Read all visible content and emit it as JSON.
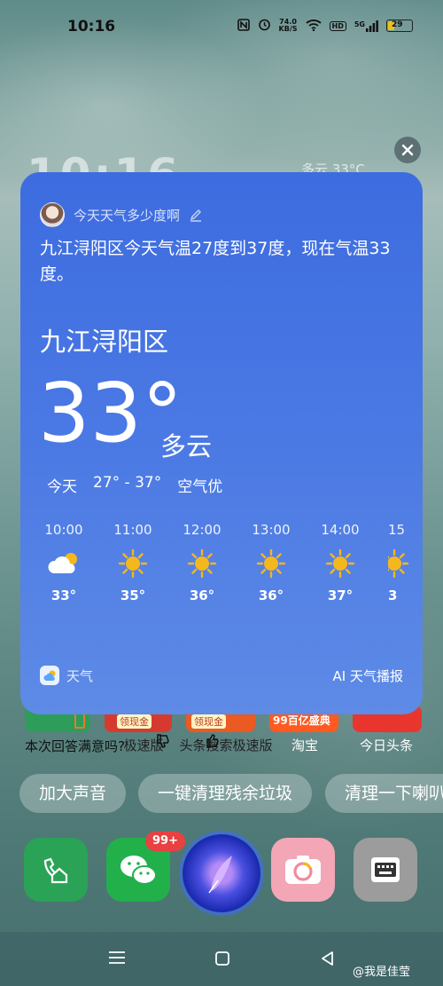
{
  "status": {
    "time": "10:16",
    "speed_value": "74.0",
    "speed_unit": "KB/S",
    "hd": "HD",
    "network": "5G",
    "battery": "29"
  },
  "background": {
    "clock": "10:16",
    "weather": "多云 33°C"
  },
  "card": {
    "query": "今天天气多少度啊",
    "answer": "九江浔阳区今天气温27度到37度，现在气温33度。",
    "city": "九江浔阳区",
    "temperature": "33°",
    "condition": "多云",
    "day_label": "今天",
    "range": "27° - 37°",
    "air": "空气优",
    "hourly": [
      {
        "time": "10:00",
        "icon": "partly-cloudy-icon",
        "temp": "33°"
      },
      {
        "time": "11:00",
        "icon": "sun-icon",
        "temp": "35°"
      },
      {
        "time": "12:00",
        "icon": "sun-icon",
        "temp": "36°"
      },
      {
        "time": "13:00",
        "icon": "sun-icon",
        "temp": "36°"
      },
      {
        "time": "14:00",
        "icon": "sun-icon",
        "temp": "37°"
      },
      {
        "time": "15",
        "icon": "sun-icon",
        "temp": "3"
      }
    ],
    "app_name": "天气",
    "broadcast": "AI 天气播报"
  },
  "apps_behind": {
    "labels": [
      "极速版",
      "头条搜索极速版",
      "淘宝",
      "今日头条"
    ],
    "tile_texts": [
      "领现金",
      "领现金",
      "99百亿盛典"
    ]
  },
  "feedback": "本次回答满意吗?",
  "chips": [
    "加大声音",
    "一键清理残余垃圾",
    "清理一下喇叭"
  ],
  "dock": {
    "wechat_badge": "99+"
  },
  "watermark": "@我是佳莹",
  "colors": {
    "card_top": "#3d6ce0",
    "card_bottom": "#5e8be6",
    "sun": "#f5b71e",
    "badge": "#e94141"
  }
}
